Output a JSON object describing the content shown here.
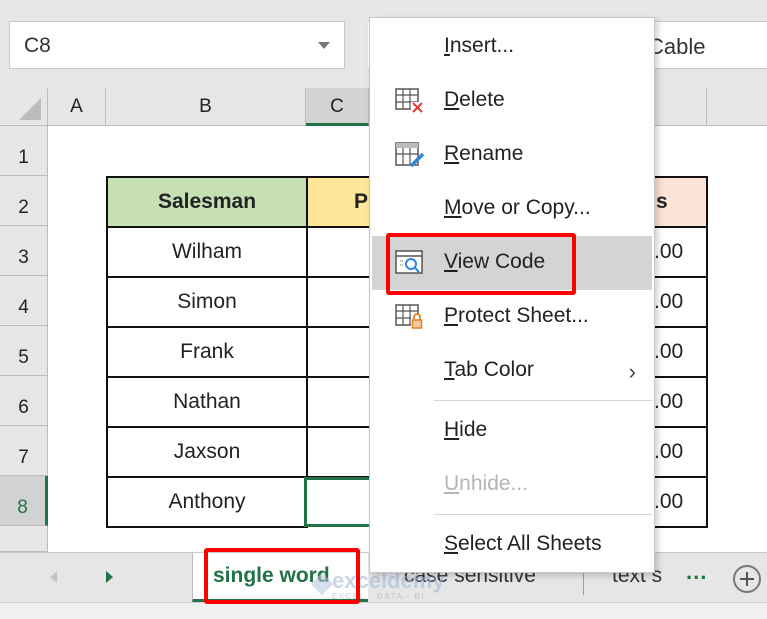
{
  "formula_bar": {
    "name_box": "C8",
    "formula_partial": "Cable"
  },
  "columns": [
    "A",
    "B",
    "C"
  ],
  "rows": [
    "1",
    "2",
    "3",
    "4",
    "5",
    "6",
    "7",
    "8"
  ],
  "selected_cell": "C8",
  "table": {
    "headers": [
      "Salesman",
      "P",
      "s"
    ],
    "header_colors": [
      "#c6e0b4",
      "#ffe699",
      "#fce4d6"
    ],
    "names": [
      "Wilham",
      "Simon",
      "Frank",
      "Nathan",
      "Jaxson",
      "Anthony"
    ],
    "last_col_values": [
      ".00",
      ".00",
      ".00",
      ".00",
      ".00",
      ".00"
    ]
  },
  "sheet_tabs": {
    "active": "single word",
    "others": [
      "case sensitive",
      "text s"
    ],
    "more": "...",
    "add_label": "New sheet"
  },
  "context_menu": {
    "items": [
      {
        "label": "Insert...",
        "accel": "I",
        "icon": null,
        "disabled": false
      },
      {
        "label": "Delete",
        "accel": "D",
        "icon": "delete-sheet-icon",
        "disabled": false
      },
      {
        "label": "Rename",
        "accel": "R",
        "icon": "rename-sheet-icon",
        "disabled": false
      },
      {
        "label": "Move or Copy...",
        "accel": "M",
        "icon": null,
        "disabled": false
      },
      {
        "label": "View Code",
        "accel": "V",
        "icon": "view-code-icon",
        "disabled": false,
        "highlighted": true
      },
      {
        "label": "Protect Sheet...",
        "accel": "P",
        "icon": "protect-sheet-icon",
        "disabled": false
      },
      {
        "label": "Tab Color",
        "accel": "T",
        "icon": null,
        "disabled": false,
        "submenu": true
      },
      {
        "label": "Hide",
        "accel": "H",
        "icon": null,
        "disabled": false
      },
      {
        "label": "Unhide...",
        "accel": "U",
        "icon": null,
        "disabled": true
      },
      {
        "label": "Select All Sheets",
        "accel": "S",
        "icon": null,
        "disabled": false
      }
    ]
  },
  "watermark": {
    "brand": "exceldemy",
    "tagline": "EXCEL - DATA - BI"
  },
  "colors": {
    "accent_green": "#217346",
    "highlight_red": "#ff0000",
    "menu_hover": "#d4d4d4"
  }
}
